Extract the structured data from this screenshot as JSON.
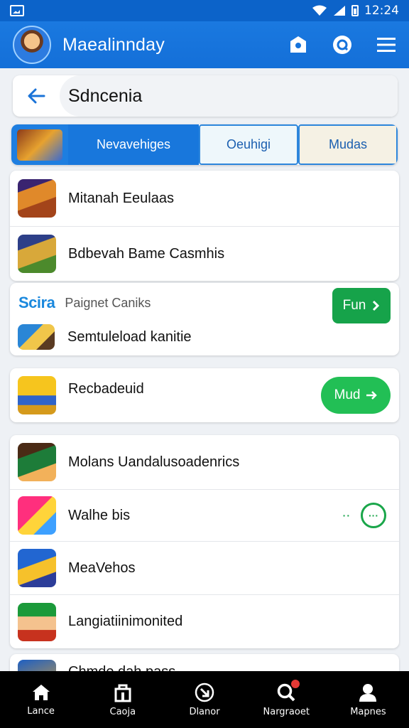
{
  "status_bar": {
    "time": "12:24"
  },
  "app_bar": {
    "title": "Maealinnday"
  },
  "search": {
    "value": "Sdncenia"
  },
  "tabs": {
    "items": [
      {
        "label": "Nevavehiges"
      },
      {
        "label": "Oeuhigi"
      },
      {
        "label": "Mudas"
      }
    ]
  },
  "group1": {
    "items": [
      {
        "label": "Mitanah Eeulaas"
      },
      {
        "label": "Bdbevah Bame Casmhis"
      }
    ]
  },
  "promo": {
    "logo": "Scira",
    "subtitle": "Paignet Caniks",
    "item_label": "Semtuleload kanitie",
    "button_label": "Fun"
  },
  "group2": {
    "item_label": "Recbadeuid",
    "button_label": "Mud"
  },
  "group3": {
    "items": [
      {
        "label": "Molans Uandalusoadenrics"
      },
      {
        "label": "Walhe bis"
      },
      {
        "label": "MeaVehos"
      },
      {
        "label": "Langiatiinimonited"
      },
      {
        "label": "Chmde dah pass"
      }
    ]
  },
  "bottom_nav": {
    "items": [
      {
        "label": "Lance"
      },
      {
        "label": "Caoja"
      },
      {
        "label": "Dlanor"
      },
      {
        "label": "Nargraoet"
      },
      {
        "label": "Mapnes"
      }
    ]
  }
}
